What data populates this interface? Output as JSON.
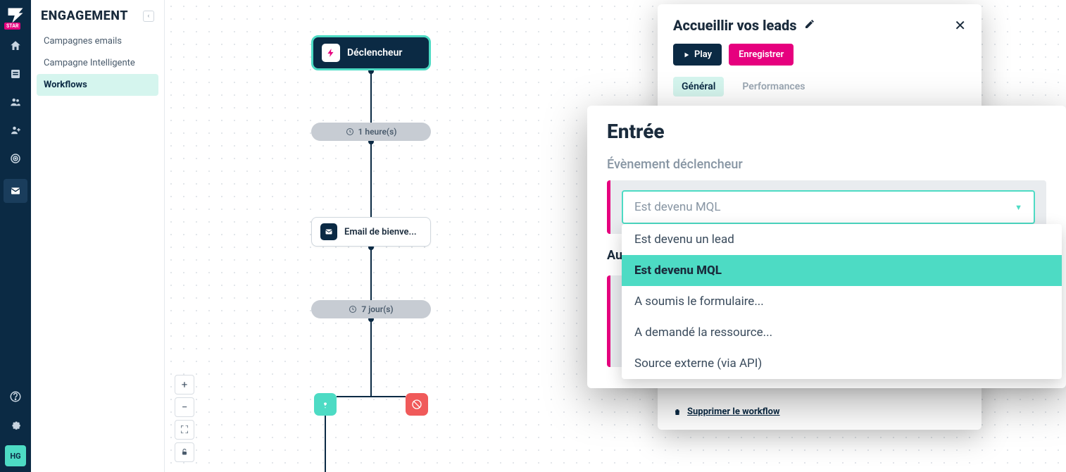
{
  "rail": {
    "avatar": "HG"
  },
  "sidebar": {
    "title": "ENGAGEMENT",
    "items": [
      {
        "label": "Campagnes emails"
      },
      {
        "label": "Campagne Intelligente"
      },
      {
        "label": "Workflows"
      }
    ]
  },
  "canvas": {
    "trigger_label": "Déclencheur",
    "delay1": "1 heure(s)",
    "delay2": "7 jour(s)",
    "email_label": "Email de bienve..."
  },
  "panel": {
    "title": "Accueillir vos leads",
    "play": "Play",
    "save": "Enregistrer",
    "tab_general": "Général",
    "tab_perf": "Performances",
    "delete": "Supprimer le workflow"
  },
  "popover": {
    "title": "Entrée",
    "section": "Évènement déclencheur",
    "truncated_section": "Au",
    "selected": "Est devenu MQL",
    "options": [
      "Est devenu un lead",
      "Est devenu MQL",
      "A soumis le formulaire...",
      "A demandé la ressource...",
      "Source externe (via API)"
    ]
  }
}
